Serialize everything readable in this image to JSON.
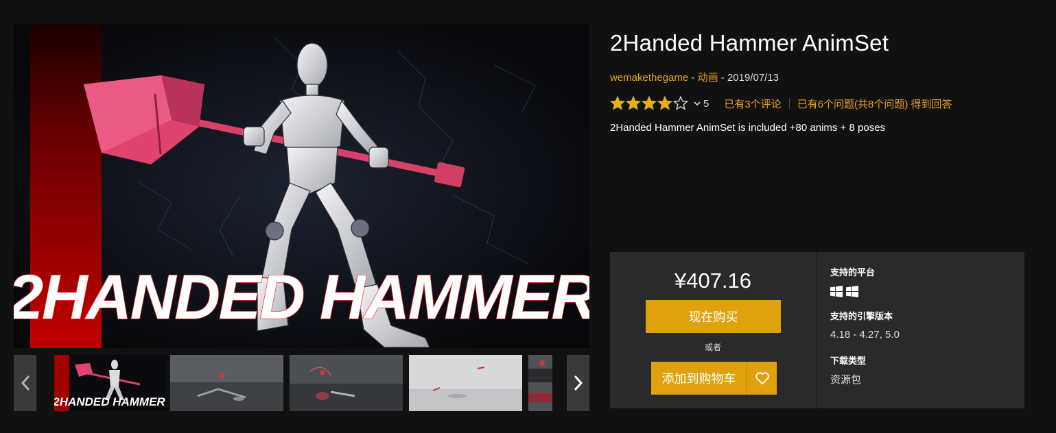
{
  "gallery": {
    "hero_title": "2HANDED HAMMER",
    "thumbnail_label": "2HANDED HAMMER",
    "prev_icon": "chevron-left-icon",
    "next_icon": "chevron-right-icon"
  },
  "product": {
    "title": "2Handed Hammer AnimSet",
    "seller": "wemakethegame",
    "separator": " - ",
    "category": "动画",
    "date": "2019/07/13",
    "rating": {
      "stars_filled": 4,
      "stars_total": 5,
      "count": "5",
      "reviews_link": "已有3个评论",
      "questions_link": "已有6个问题(共8个问题) 得到回答"
    },
    "description": "2Handed Hammer AnimSet is included +80 anims + 8 poses"
  },
  "purchase": {
    "price": "¥407.16",
    "buy_label": "现在购买",
    "or_label": "或者",
    "cart_label": "添加到购物车",
    "wishlist_icon": "heart-icon"
  },
  "specs": {
    "platforms_label": "支持的平台",
    "platform_icons": [
      "windows-icon",
      "windows-icon"
    ],
    "engine_label": "支持的引擎版本",
    "engine_value": "4.18 - 4.27, 5.0",
    "download_label": "下载类型",
    "download_value": "资源包"
  },
  "colors": {
    "accent": "#e0a20c",
    "link": "#e8a21b",
    "background": "#111111",
    "panel": "#2a2a2a",
    "hammer": "#e0446e"
  }
}
